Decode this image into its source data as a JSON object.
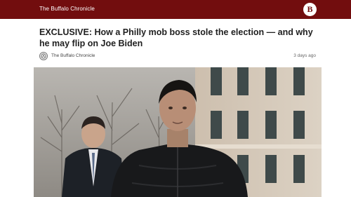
{
  "header": {
    "site_name": "The Buffalo Chronicle",
    "logo_glyph": "B",
    "background_color": "#720d0e"
  },
  "article": {
    "headline": "EXCLUSIVE: How a Philly mob boss stole the election — and why he may flip on Joe Biden",
    "source": "The Buffalo Chronicle",
    "time_ago": "3 days ago",
    "image": {
      "icon": "photo-man-in-black-jacket-on-street"
    }
  }
}
